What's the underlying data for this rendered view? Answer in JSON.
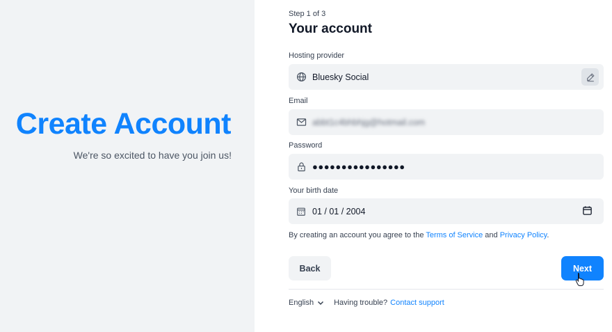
{
  "hero": {
    "title": "Create Account",
    "subtitle": "We're so excited to have you join us!"
  },
  "form": {
    "step": "Step 1 of 3",
    "title": "Your account",
    "hosting": {
      "label": "Hosting provider",
      "value": "Bluesky Social",
      "icon": "globe-icon",
      "action_icon": "pencil-icon"
    },
    "email": {
      "label": "Email",
      "value": "abbt1c4bhbhjg@hotmail.com",
      "icon": "envelope-icon"
    },
    "password": {
      "label": "Password",
      "value": "●●●●●●●●●●●●●●●●",
      "icon": "lock-icon"
    },
    "birth": {
      "label": "Your birth date",
      "value": "01 / 01 / 2004",
      "icon": "calendar-icon",
      "picker_icon": "calendar-picker-icon"
    },
    "terms": {
      "prefix": "By creating an account you agree to the ",
      "tos": "Terms of Service",
      "and": " and ",
      "privacy": "Privacy Policy",
      "suffix": "."
    },
    "back_label": "Back",
    "next_label": "Next"
  },
  "footer": {
    "language": "English",
    "trouble": "Having trouble?",
    "support": "Contact support"
  },
  "colors": {
    "accent": "#1083fe",
    "panel_bg": "#f1f3f5",
    "field_bg": "#f1f3f5"
  }
}
